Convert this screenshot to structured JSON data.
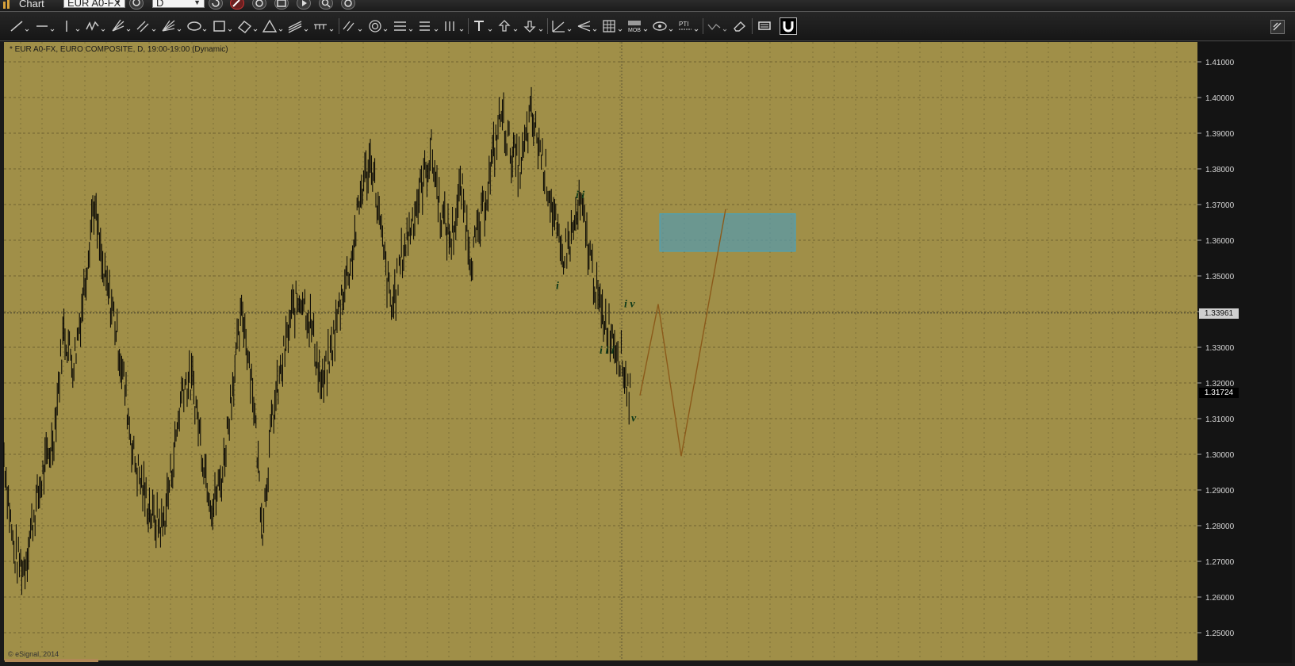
{
  "titlebar": {
    "app_title": "Chart",
    "symbol": "EUR A0-FX",
    "interval": "D"
  },
  "toolbar": {
    "tools": [
      "trendline-icon",
      "horizontal-line-icon",
      "vertical-line-icon",
      "polyline-icon",
      "pitchfork-icon",
      "parallel-channel-icon",
      "fan-icon",
      "ellipse-icon",
      "rectangle-icon",
      "ruler-icon",
      "triangle-icon",
      "regression-channel-icon",
      "cycle-lines-icon",
      "fibonacci-lines-icon",
      "circles-icon",
      "fib-retracement-icon",
      "fib-extension-icon",
      "time-zones-icon",
      "text-icon",
      "arrow-up-icon",
      "arrow-down-icon",
      "gann-fan-icon",
      "speed-lines-icon",
      "grid-icon",
      "mob-icon",
      "eye-icon",
      "pti-icon",
      "auto-wave-icon",
      "eraser-icon",
      "toggle-panel-icon",
      "magnet-icon"
    ],
    "mob_label": "MOB",
    "pti_label": "PTI"
  },
  "chart": {
    "header": "* EUR A0-FX, EURO COMPOSITE, D, 19:00-19:00 (Dynamic)",
    "copyright": "© eSignal, 2014",
    "background_color": "#a08f48",
    "bar_color": "#000000",
    "price_axis": {
      "min": 1.25,
      "max": 1.41,
      "step": 0.01,
      "labels": [
        "1.41000",
        "1.40000",
        "1.39000",
        "1.38000",
        "1.37000",
        "1.36000",
        "1.35000",
        "1.34000",
        "1.33000",
        "1.32000",
        "1.31000",
        "1.30000",
        "1.29000",
        "1.28000",
        "1.27000",
        "1.26000",
        "1.25000"
      ]
    },
    "crosshair_price": "1.33961",
    "last_price": "1.31724",
    "wave_labels": [
      "i",
      "i i",
      "i i i",
      "i v",
      "v"
    ],
    "wave_label_color": "#0f3a1a",
    "target_box": {
      "price_top": 1.3674,
      "price_bottom": 1.3569,
      "color": "#5a9aa8"
    },
    "projection_path": [
      1.3165,
      1.3421,
      1.2995,
      1.3687
    ],
    "projection_color": "#8b5a1a",
    "price_path": [
      1.3,
      1.272,
      1.268,
      1.283,
      1.295,
      1.305,
      1.335,
      1.325,
      1.345,
      1.371,
      1.35,
      1.34,
      1.322,
      1.3,
      1.29,
      1.282,
      1.28,
      1.298,
      1.32,
      1.32,
      1.3,
      1.285,
      1.295,
      1.32,
      1.34,
      1.32,
      1.28,
      1.31,
      1.325,
      1.34,
      1.345,
      1.335,
      1.318,
      1.33,
      1.345,
      1.355,
      1.375,
      1.383,
      1.36,
      1.34,
      1.355,
      1.365,
      1.375,
      1.385,
      1.367,
      1.36,
      1.375,
      1.355,
      1.365,
      1.38,
      1.396,
      1.385,
      1.38,
      1.395,
      1.385,
      1.372,
      1.355,
      1.36,
      1.37,
      1.355,
      1.34,
      1.335,
      1.328,
      1.316
    ]
  }
}
